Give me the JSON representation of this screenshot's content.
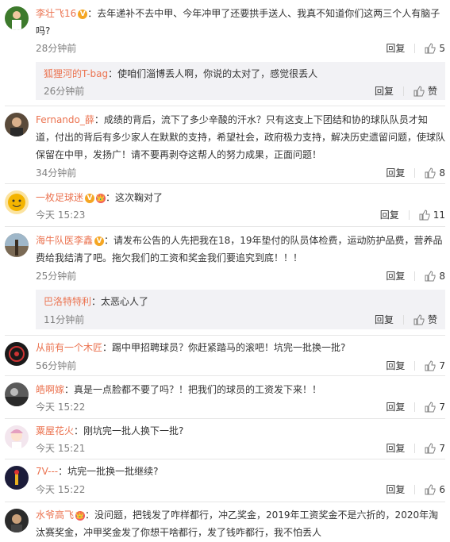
{
  "reply_label": "回复",
  "like_label": "赞",
  "comments": [
    {
      "user": "李壮飞16",
      "badge": "V",
      "colon": "：",
      "text": "去年递补不去中甲、今年冲甲了还要拱手送人、我真不知道你们这两三个人有脑子吗?",
      "time": "28分钟前",
      "likes": "5",
      "reply": {
        "user": "狐狸河的T-bag",
        "text": "：使咱们淄博丢人啊，你说的太对了，感觉很丢人",
        "time": "26分钟前"
      }
    },
    {
      "user": "Fernando_薛",
      "text": "：成绩的背后，流下了多少辛酸的汗水？只有这支上下团结和协的球队队员才知道，付出的背后有多少家人在默默的支持，希望社会，政府极力支持，解决历史遗留问题，使球队保留在中甲，发扬广！请不要再剥夺这帮人的努力成果，正面问题！",
      "time": "34分钟前",
      "likes": "8"
    },
    {
      "user": "一枚足球迷",
      "badge": "V",
      "badge2": "👑",
      "text": "：这次鞠对了",
      "time": "今天 15:23",
      "likes": "11"
    },
    {
      "user": "海牛队医李鑫",
      "badge": "V",
      "text": "：请发布公告的人先把我在18，19年垫付的队员体检费，运动防护品费，营养品费给我结清了吧。拖欠我们的工资和奖金我们要追究到底！！！",
      "time": "25分钟前",
      "likes": "8",
      "reply": {
        "user": "巴洛特特利",
        "text": "：太恶心人了",
        "time": "11分钟前"
      }
    },
    {
      "user": "从前有一个木匠",
      "text": "：踢中甲招聘球员？你赶紧踏马的滚吧！坑完一批换一批?",
      "time": "56分钟前",
      "likes": "7"
    },
    {
      "user": "皓啊嫁",
      "text": "：真是一点脸都不要了吗？！把我们的球员的工资发下来！！",
      "time": "今天 15:22",
      "likes": "7"
    },
    {
      "user": "粟屋花火",
      "text": "：刚坑完一批人换下一批?",
      "time": "今天 15:21",
      "likes": "7"
    },
    {
      "user": "7V---",
      "text": "：坑完一批换一批继续?",
      "time": "今天 15:22",
      "likes": "6"
    },
    {
      "user": "水爷高飞",
      "badge2": "👑",
      "text": "：没问题，把钱发了咋样都行，冲乙奖金，2019年工资奖金不是六折的，2020年淘汰赛奖金，冲甲奖金发了你想干啥都行，发了钱咋都行，我不怕丢人"
    }
  ]
}
